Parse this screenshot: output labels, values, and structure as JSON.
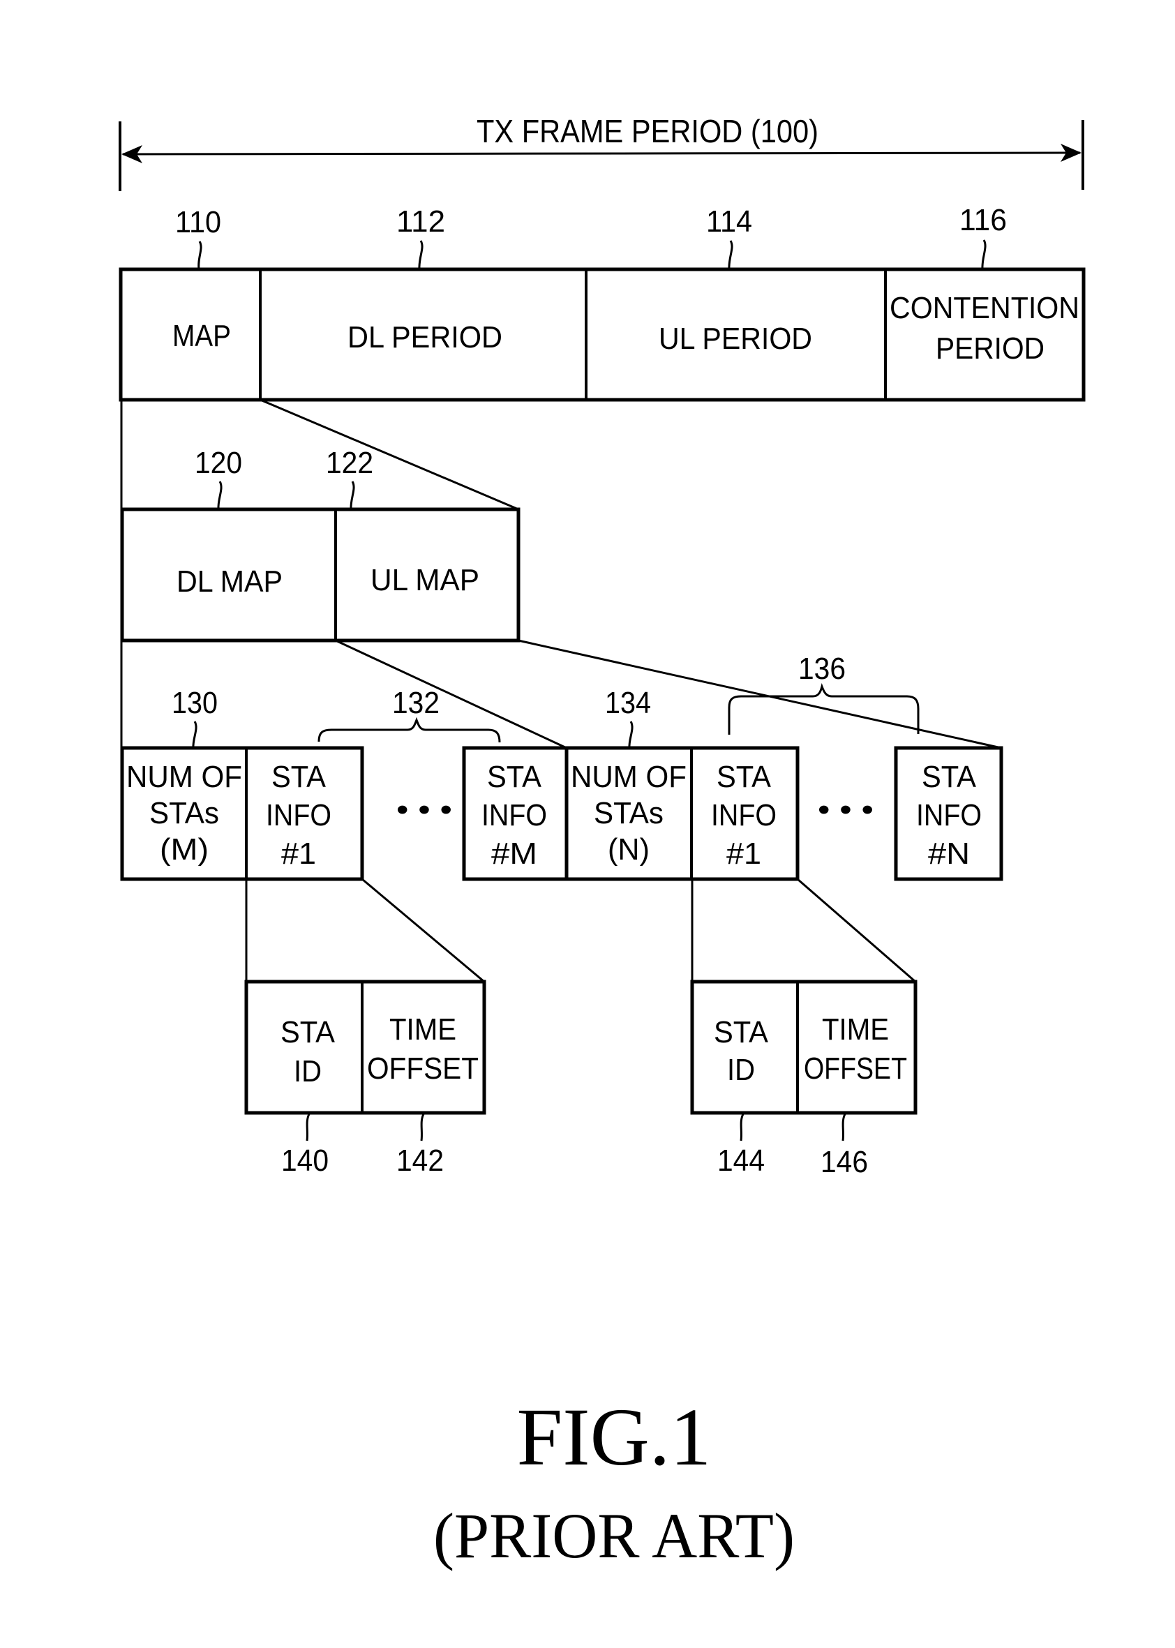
{
  "frame": {
    "title": "TX FRAME PERIOD (100)",
    "segments": [
      {
        "ref": "110",
        "lines": [
          "MAP"
        ]
      },
      {
        "ref": "112",
        "lines": [
          "DL PERIOD"
        ]
      },
      {
        "ref": "114",
        "lines": [
          "UL PERIOD"
        ]
      },
      {
        "ref": "116",
        "lines": [
          "CONTENTION",
          "PERIOD"
        ]
      }
    ]
  },
  "map": {
    "segments": [
      {
        "ref": "120",
        "lines": [
          "DL MAP"
        ]
      },
      {
        "ref": "122",
        "lines": [
          "UL MAP"
        ]
      }
    ]
  },
  "dl_map_fields": {
    "num_ref": "130",
    "group_ref": "132",
    "cells": [
      {
        "lines": [
          "NUM OF",
          "STAs",
          "(M)"
        ]
      },
      {
        "lines": [
          "STA",
          "INFO",
          "#1"
        ]
      },
      {
        "lines": [
          "STA",
          "INFO",
          "#M"
        ]
      }
    ],
    "ellipsis": "• • •"
  },
  "ul_map_fields": {
    "num_ref": "134",
    "group_ref": "136",
    "cells": [
      {
        "lines": [
          "NUM OF",
          "STAs",
          "(N)"
        ]
      },
      {
        "lines": [
          "STA",
          "INFO",
          "#1"
        ]
      },
      {
        "lines": [
          "STA",
          "INFO",
          "#N"
        ]
      }
    ],
    "ellipsis": "• • •"
  },
  "dl_sta_info": {
    "cells": [
      {
        "ref": "140",
        "lines": [
          "STA",
          "ID"
        ]
      },
      {
        "ref": "142",
        "lines": [
          "TIME",
          "OFFSET"
        ]
      }
    ]
  },
  "ul_sta_info": {
    "cells": [
      {
        "ref": "144",
        "lines": [
          "STA",
          "ID"
        ]
      },
      {
        "ref": "146",
        "lines": [
          "TIME",
          "OFFSET"
        ]
      }
    ]
  },
  "caption": {
    "figure": "FIG.1",
    "note": "(PRIOR ART)"
  }
}
